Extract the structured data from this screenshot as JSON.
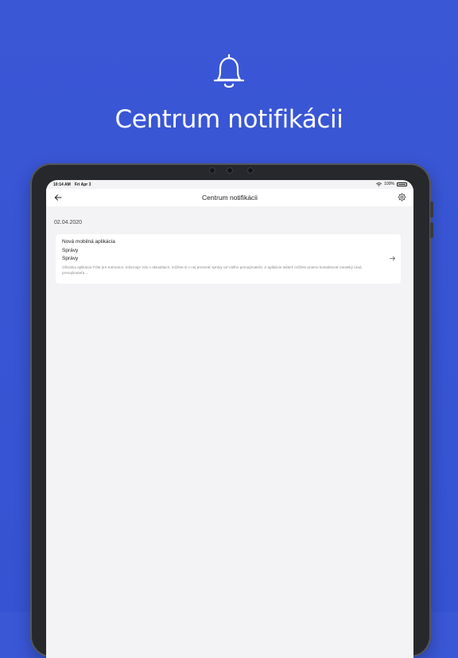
{
  "hero": {
    "icon": "bell-icon",
    "title": "Centrum notifikácii"
  },
  "status_bar": {
    "time": "10:14 AM",
    "date": "Fri Apr 3",
    "battery": "100%"
  },
  "nav": {
    "title": "Centrum notifikácii",
    "back_icon": "back-arrow-icon",
    "settings_icon": "gear-icon"
  },
  "feed": {
    "date_header": "02.04.2020",
    "notification": {
      "title": "Nová mobilná aplikácia",
      "category": "Správy",
      "subtitle": "Správy",
      "body": "Oficiálna aplikácia TOM pre Ketmanın. Informuje Vás o aktualitách, môžete si v nej prezerať správy od Vášho prenajímateľa. Z aplikácie taktiež môžete priamo kontaktovať mestský úrad, prenajímateľa ...",
      "arrow_icon": "arrow-right-icon"
    }
  },
  "colors": {
    "background": "#3553d2",
    "screen": "#f3f3f5",
    "card": "#ffffff"
  }
}
